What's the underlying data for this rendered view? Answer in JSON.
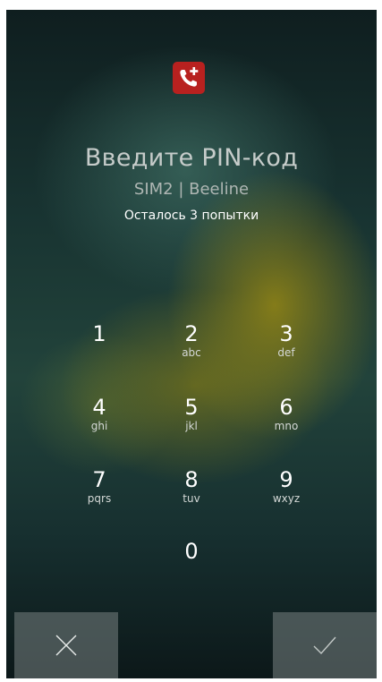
{
  "header": {
    "app_icon": "phone-plus-icon",
    "title": "Введите PIN-код",
    "subtitle": "SIM2 | Beeline",
    "attempts": "Осталось 3 попытки"
  },
  "keypad": {
    "keys": [
      {
        "digit": "1",
        "letters": ""
      },
      {
        "digit": "2",
        "letters": "abc"
      },
      {
        "digit": "3",
        "letters": "def"
      },
      {
        "digit": "4",
        "letters": "ghi"
      },
      {
        "digit": "5",
        "letters": "jkl"
      },
      {
        "digit": "6",
        "letters": "mno"
      },
      {
        "digit": "7",
        "letters": "pqrs"
      },
      {
        "digit": "8",
        "letters": "tuv"
      },
      {
        "digit": "9",
        "letters": "wxyz"
      },
      {
        "digit": "0",
        "letters": ""
      }
    ]
  },
  "actions": {
    "cancel_icon": "close-icon",
    "confirm_icon": "checkmark-icon"
  },
  "colors": {
    "app_icon_bg": "#b8211f",
    "text_primary": "#ffffff",
    "text_secondary": "#c6ccca"
  }
}
